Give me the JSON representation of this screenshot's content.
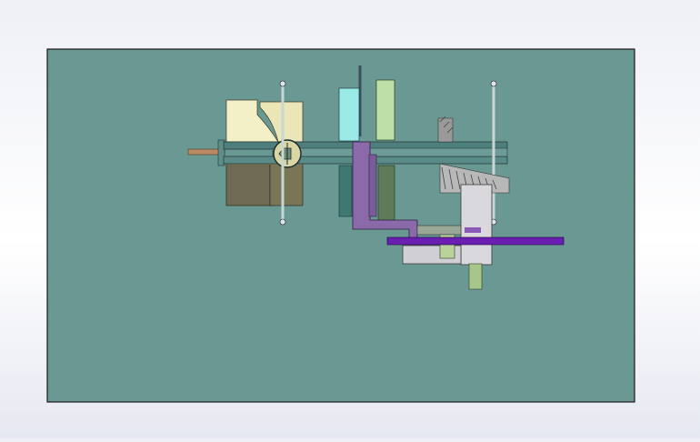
{
  "app": {
    "kind": "cad-3d-viewport",
    "colors": {
      "background_top": "#eef0f6",
      "background_bottom": "#e6e8f1",
      "plate": "#6a9893",
      "plate_border": "#1a1a1a",
      "cream_part": "#f2efc4",
      "olive_part": "#6f6a52",
      "cyan_part": "#8fe3df",
      "light_green_part": "#b9dba2",
      "purple_bracket": "#8a6aa8",
      "purple_rod": "#6a1fb2",
      "gray_part": "#d8d8dc",
      "shaft": "#5b8583"
    }
  },
  "model": {
    "parts": [
      {
        "name": "base-plate"
      },
      {
        "name": "cream-block"
      },
      {
        "name": "olive-block"
      },
      {
        "name": "main-shaft"
      },
      {
        "name": "cyan-disc"
      },
      {
        "name": "green-disc"
      },
      {
        "name": "purple-bracket"
      },
      {
        "name": "bevel-gear"
      },
      {
        "name": "gray-housing"
      },
      {
        "name": "purple-rod"
      },
      {
        "name": "vertical-pins"
      }
    ]
  }
}
